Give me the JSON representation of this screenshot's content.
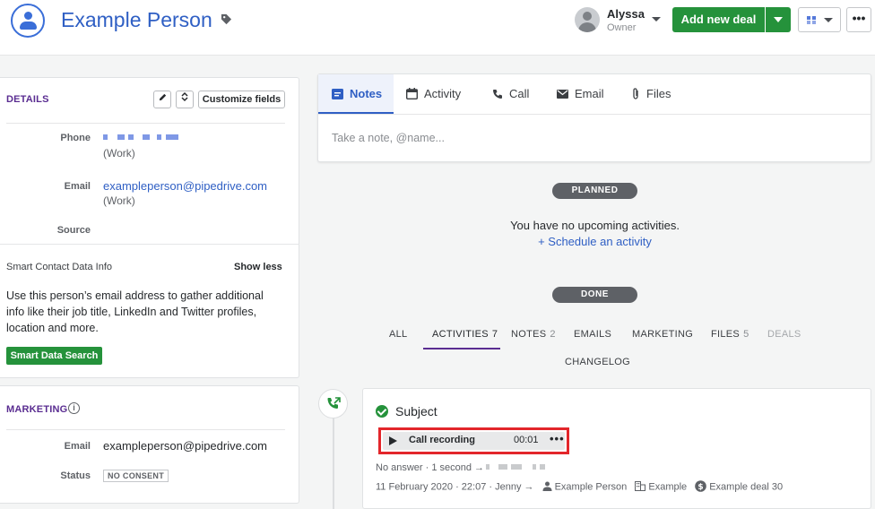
{
  "header": {
    "person_name": "Example Person",
    "owner_name": "Alyssa",
    "owner_role": "Owner",
    "add_deal_label": "Add new deal",
    "more_label": "•••"
  },
  "details": {
    "title": "DETAILS",
    "customize_label": "Customize fields",
    "phone_label": "Phone",
    "phone_type": "(Work)",
    "email_label": "Email",
    "email_value": "exampleperson@pipedrive.com",
    "email_type": "(Work)",
    "source_label": "Source",
    "smart_title": "Smart Contact Data Info",
    "show_less": "Show less",
    "smart_desc": "Use this person’s email address to gather additional info like their job title, LinkedIn and Twitter profiles, location and more.",
    "smart_button": "Smart Data Search"
  },
  "marketing": {
    "title": "MARKETING",
    "info_icon": "i",
    "email_label": "Email",
    "email_value": "exampleperson@pipedrive.com",
    "status_label": "Status",
    "status_value": "NO CONSENT"
  },
  "composer": {
    "tabs": [
      {
        "label": "Notes",
        "icon": "note-icon"
      },
      {
        "label": "Activity",
        "icon": "calendar-icon"
      },
      {
        "label": "Call",
        "icon": "phone-icon"
      },
      {
        "label": "Email",
        "icon": "envelope-icon"
      },
      {
        "label": "Files",
        "icon": "paperclip-icon"
      }
    ],
    "placeholder": "Take a note, @name..."
  },
  "feed": {
    "planned_label": "PLANNED",
    "empty_text": "You have no upcoming activities.",
    "schedule_link": "+ Schedule an activity",
    "done_label": "DONE",
    "filters": [
      {
        "label": "ALL",
        "count": ""
      },
      {
        "label": "ACTIVITIES",
        "count": "7"
      },
      {
        "label": "NOTES",
        "count": "2"
      },
      {
        "label": "EMAILS",
        "count": ""
      },
      {
        "label": "MARKETING",
        "count": ""
      },
      {
        "label": "FILES",
        "count": "5"
      },
      {
        "label": "DEALS",
        "count": ""
      },
      {
        "label": "CHANGELOG",
        "count": ""
      }
    ]
  },
  "activity": {
    "subject": "Subject",
    "recording_label": "Call recording",
    "recording_time": "00:01",
    "recording_more": "•••",
    "meta_line1": "No answer · 1 second →",
    "meta_date": "11 February 2020 · 22:07 · Jenny →",
    "meta_person": "Example Person",
    "meta_org": "Example",
    "meta_deal": "Example deal 30"
  },
  "colors": {
    "brand_green": "#25923b",
    "link_blue": "#2f5fc4",
    "section_purple": "#5a2d91",
    "highlight_red": "#e3262b"
  }
}
